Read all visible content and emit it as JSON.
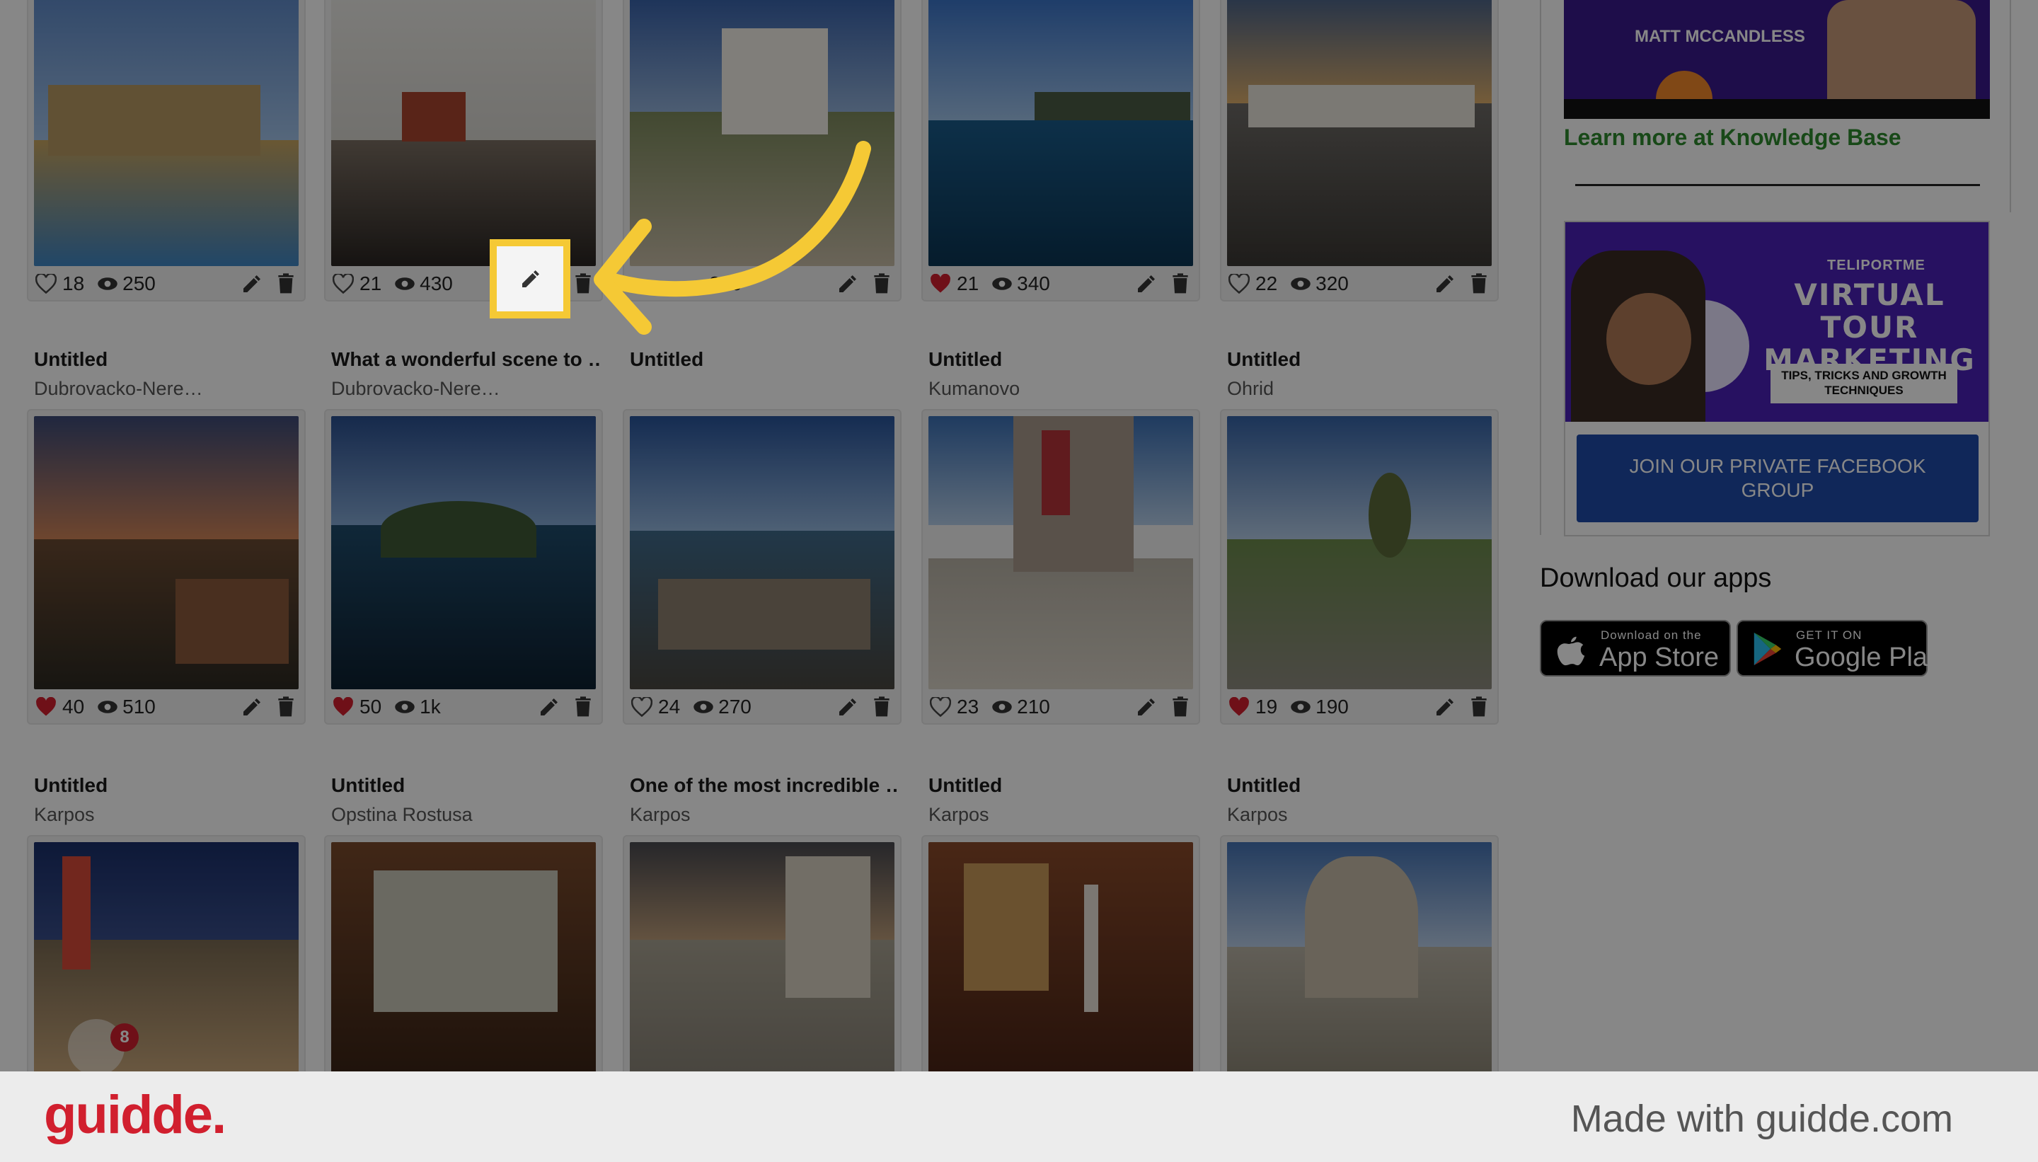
{
  "colors": {
    "accent_green": "#2f8a2f",
    "heart_red": "#d11f2e",
    "facebook_blue": "#1f4aa8",
    "highlight_yellow": "#f5c935",
    "brand_red": "#d11f2e"
  },
  "icons": {
    "like": "heart-icon",
    "views": "eye-icon",
    "edit": "pencil-icon",
    "delete": "trash-icon"
  },
  "rows": [
    {
      "cards": [
        {
          "title": "",
          "location": "",
          "likes": "18",
          "views": "250",
          "liked": false
        },
        {
          "title": "",
          "location": "",
          "likes": "21",
          "views": "430",
          "liked": false
        },
        {
          "title": "",
          "location": "",
          "likes": "",
          "views": "240",
          "liked": false
        },
        {
          "title": "",
          "location": "",
          "likes": "21",
          "views": "340",
          "liked": true
        },
        {
          "title": "",
          "location": "",
          "likes": "22",
          "views": "320",
          "liked": false
        }
      ]
    },
    {
      "cards": [
        {
          "title": "Untitled",
          "location": "Dubrovacko-Nere…",
          "likes": "40",
          "views": "510",
          "liked": true
        },
        {
          "title": "What a wonderful scene to …",
          "location": "Dubrovacko-Nere…",
          "likes": "50",
          "views": "1k",
          "liked": true
        },
        {
          "title": "Untitled",
          "location": "",
          "likes": "24",
          "views": "270",
          "liked": false
        },
        {
          "title": "Untitled",
          "location": "Kumanovo",
          "likes": "23",
          "views": "210",
          "liked": false
        },
        {
          "title": "Untitled",
          "location": "Ohrid",
          "likes": "19",
          "views": "190",
          "liked": true
        }
      ]
    },
    {
      "cards": [
        {
          "title": "Untitled",
          "location": "Karpos"
        },
        {
          "title": "Untitled",
          "location": "Opstina Rostusa"
        },
        {
          "title": "One of the most incredible …",
          "location": "Karpos"
        },
        {
          "title": "Untitled",
          "location": "Karpos"
        },
        {
          "title": "Untitled",
          "location": "Karpos"
        }
      ]
    }
  ],
  "sidebar": {
    "promo1_name": "MATT MCCANDLESS",
    "kb_link": "Learn more at Knowledge Base",
    "promo2": {
      "brand": "TELIPORTME",
      "headline_1": "VIRTUAL TOUR",
      "headline_2": "MARKETING",
      "tagline": "TIPS, TRICKS AND GROWTH TECHNIQUES",
      "button": "JOIN OUR PRIVATE FACEBOOK GROUP"
    },
    "apps_title": "Download our apps",
    "app_store": {
      "small": "Download on the",
      "big": "App Store"
    },
    "google_play": {
      "small": "GET IT ON",
      "big": "Google Play"
    }
  },
  "badge": {
    "count": "8"
  },
  "footer": {
    "logo": "guidde.",
    "made_with": "Made with guidde.com"
  }
}
